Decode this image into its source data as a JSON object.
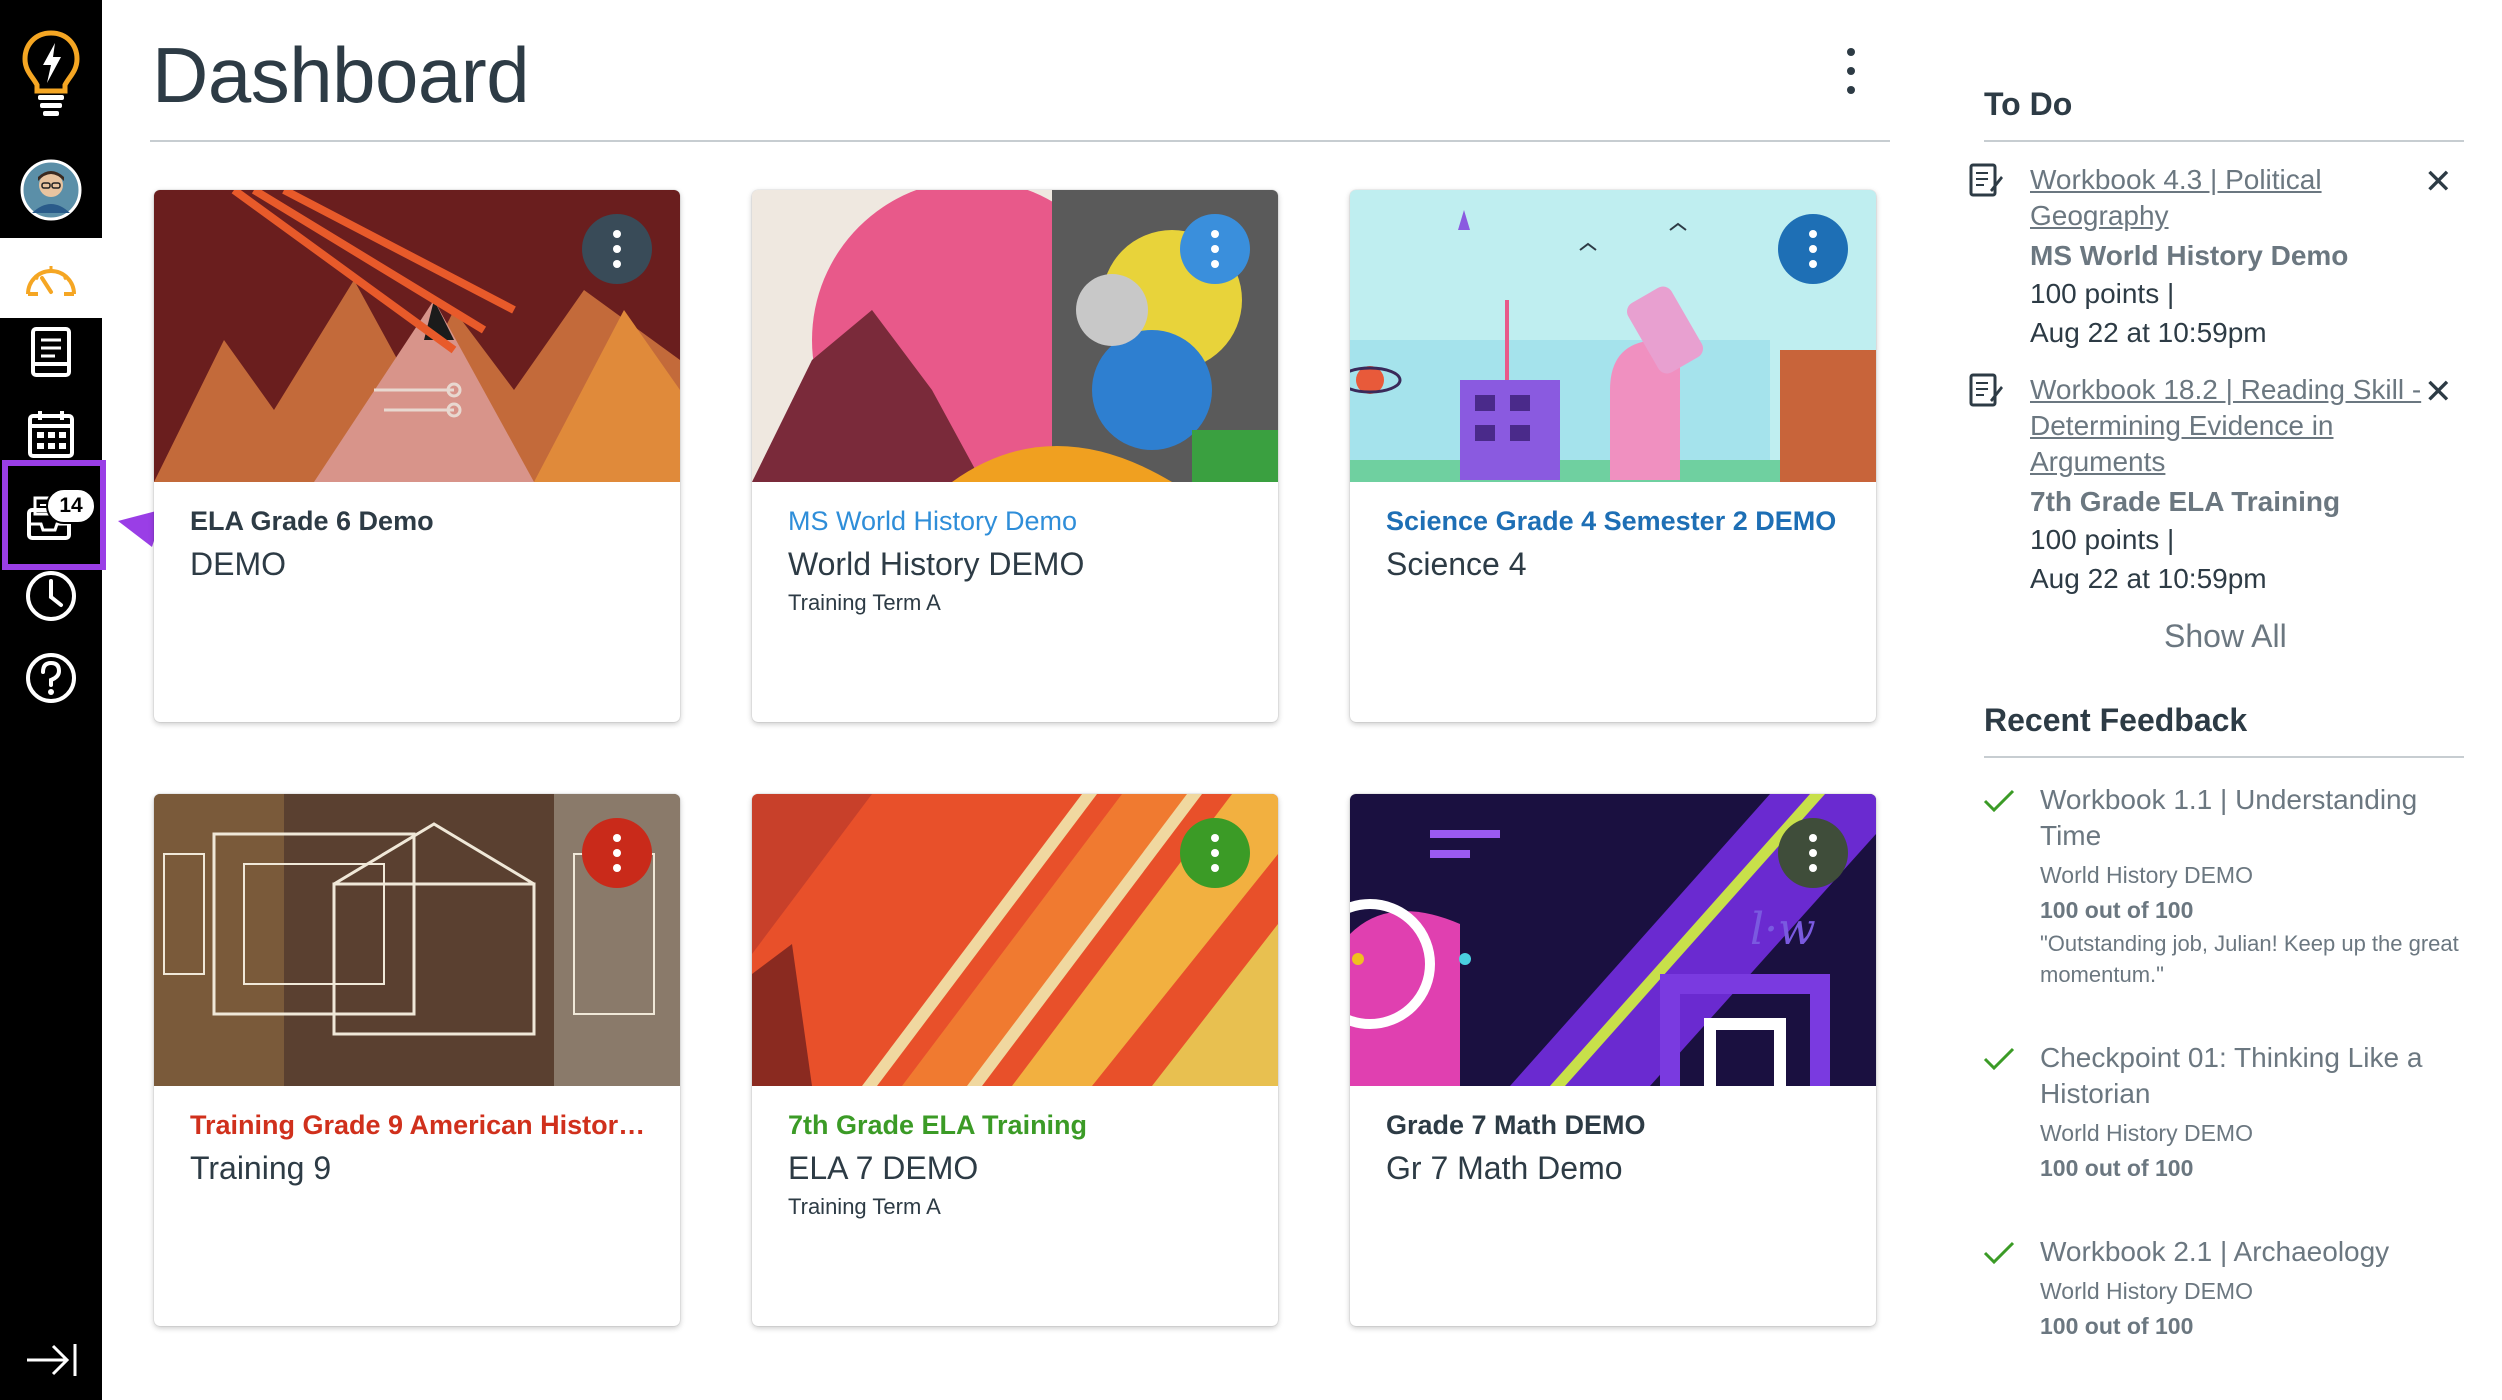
{
  "header": {
    "title": "Dashboard"
  },
  "sidebar": {
    "items": [
      {
        "name": "logo",
        "icon": "lightbulb-logo-icon"
      },
      {
        "name": "account",
        "icon": "avatar"
      },
      {
        "name": "dashboard",
        "icon": "speedometer-icon",
        "active": true
      },
      {
        "name": "courses",
        "icon": "book-icon"
      },
      {
        "name": "calendar",
        "icon": "calendar-icon"
      },
      {
        "name": "inbox",
        "icon": "inbox-icon",
        "badge": "14"
      },
      {
        "name": "history",
        "icon": "clock-icon"
      },
      {
        "name": "help",
        "icon": "question-icon"
      },
      {
        "name": "collapse",
        "icon": "collapse-arrow-icon"
      }
    ],
    "highlight_color": "#9a3ee6"
  },
  "cards": [
    {
      "name": "ELA Grade 6 Demo",
      "code": "DEMO",
      "term": "",
      "color": "#2d3b45",
      "kebab": "#394b58"
    },
    {
      "name": "MS World History Demo",
      "code": "World History DEMO",
      "term": "Training Term A",
      "color": "#2f8ed9",
      "kebab": "#3a8fdc"
    },
    {
      "name": "Science Grade 4 Semester 2 DEMO",
      "code": "Science 4",
      "term": "",
      "color": "#1e6fb5",
      "kebab": "#1e6fb5"
    },
    {
      "name": "Training Grade 9 American History...",
      "code": "Training 9",
      "term": "",
      "color": "#d0301c",
      "kebab": "#c92a1a"
    },
    {
      "name": "7th Grade ELA Training",
      "code": "ELA 7 DEMO",
      "term": "Training Term A",
      "color": "#3b9b26",
      "kebab": "#3b9b26"
    },
    {
      "name": "Grade 7 Math DEMO",
      "code": "Gr 7 Math Demo",
      "term": "",
      "color": "#3a4b35",
      "kebab": "#3f4d3a"
    }
  ],
  "todo": {
    "heading": "To Do",
    "items": [
      {
        "link": "Workbook 4.3 | Political Geography",
        "course": "MS World History Demo",
        "points": "100 points  |",
        "due": "Aug 22 at 10:59pm"
      },
      {
        "link": "Workbook 18.2 | Reading Skill - Determining Evidence in Arguments",
        "course": "7th Grade ELA Training",
        "points": "100 points  |",
        "due": "Aug 22 at 10:59pm"
      }
    ],
    "show_all": "Show All"
  },
  "feedback": {
    "heading": "Recent Feedback",
    "items": [
      {
        "title": "Workbook 1.1 | Understanding Time",
        "course": "World History DEMO",
        "score": "100 out of 100",
        "comment": "\"Outstanding job, Julian! Keep up the great momentum.\""
      },
      {
        "title": "Checkpoint 01: Thinking Like a Historian",
        "course": "World History DEMO",
        "score": "100 out of 100",
        "comment": ""
      },
      {
        "title": "Workbook 2.1 | Archaeology",
        "course": "World History DEMO",
        "score": "100 out of 100",
        "comment": ""
      }
    ]
  }
}
